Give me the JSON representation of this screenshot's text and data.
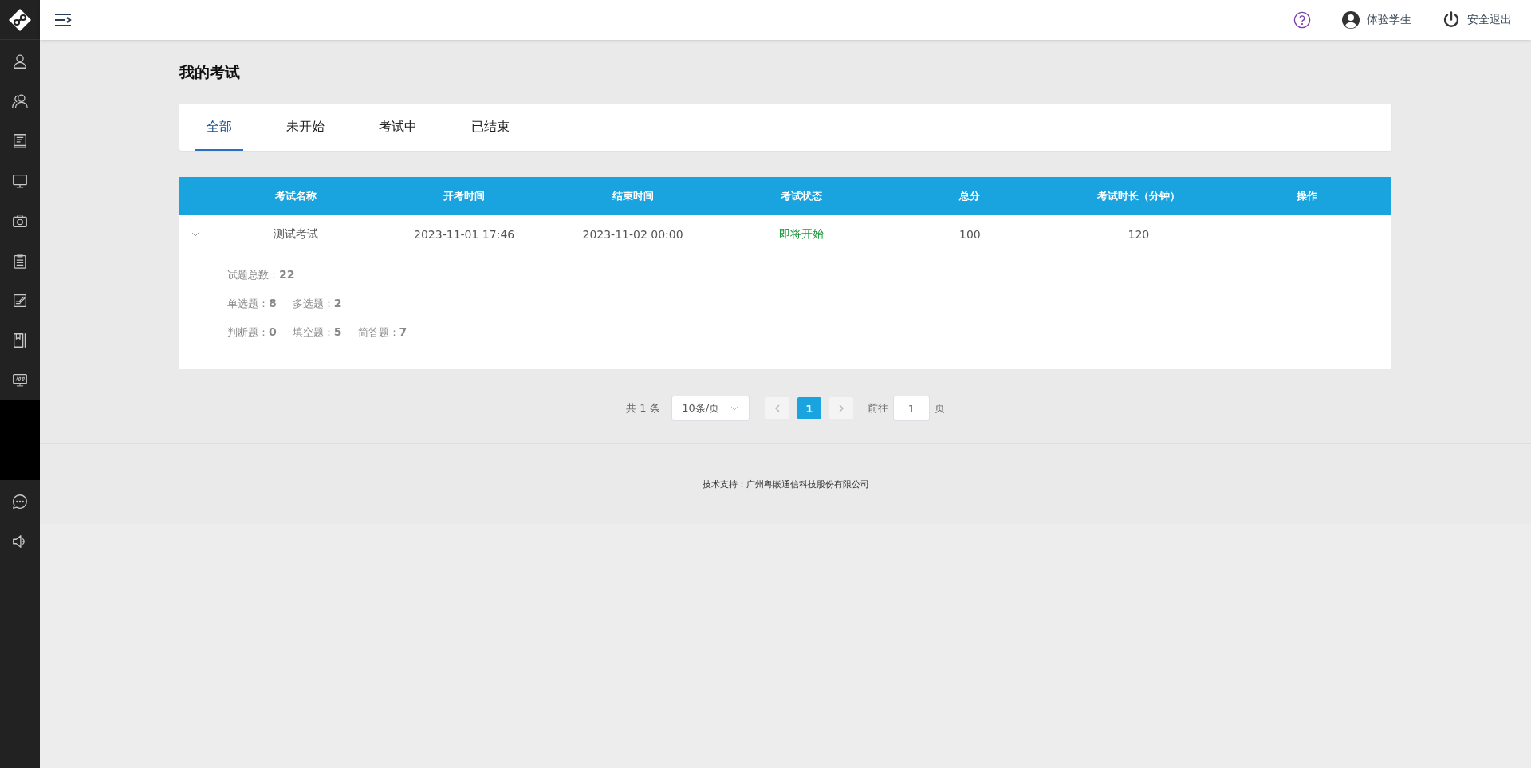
{
  "header": {
    "user_name": "体验学生",
    "logout": "安全退出"
  },
  "page_title": "我的考试",
  "tabs": [
    {
      "label": "全部",
      "selected": true
    },
    {
      "label": "未开始",
      "selected": false
    },
    {
      "label": "考试中",
      "selected": false
    },
    {
      "label": "已结束",
      "selected": false
    }
  ],
  "table": {
    "columns": [
      "考试名称",
      "开考时间",
      "结束时间",
      "考试状态",
      "总分",
      "考试时长（分钟）",
      "操作"
    ],
    "rows": [
      {
        "expanded": true,
        "cells": [
          "测试考试",
          "2023-11-01 17:46",
          "2023-11-02 00:00",
          "即将开始",
          "100",
          "120"
        ],
        "details": [
          [
            "试题总数：**22**"
          ],
          [
            "单选题：**8**",
            "多选题：**2**"
          ],
          [
            "判断题：**0**",
            "填空题：**5**",
            "简答题：**7**"
          ]
        ]
      }
    ]
  },
  "pagination": {
    "total": "共 1 条",
    "page_size": "10条/页",
    "pages": [
      {
        "label": "1",
        "selected": true
      }
    ],
    "goto_label": "前往",
    "goto_value": "1",
    "goto_unit": "页"
  },
  "footer": "技术支持：广州粤嵌通信科技股份有限公司"
}
